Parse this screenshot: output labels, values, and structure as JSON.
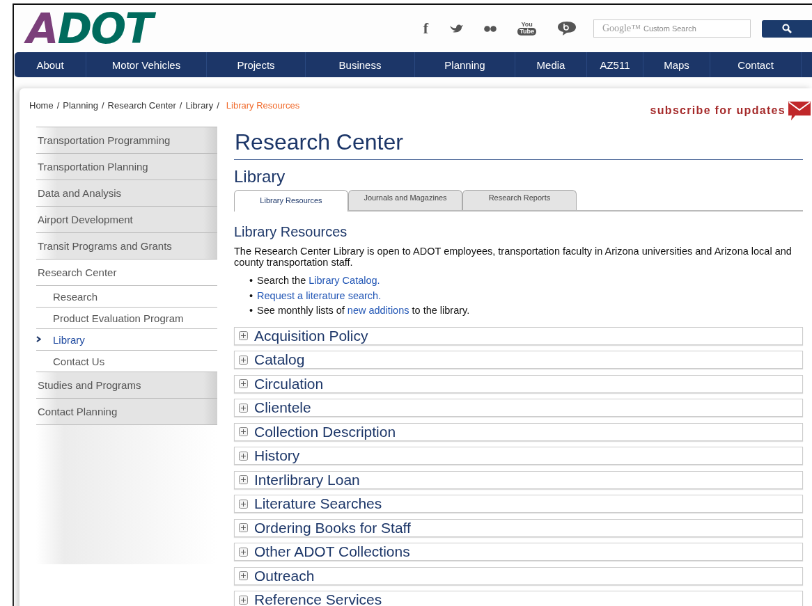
{
  "header": {
    "logo": {
      "first": "A",
      "rest": "DOT"
    },
    "social": [
      {
        "kind": "facebook",
        "glyph": "f"
      },
      {
        "kind": "twitter"
      },
      {
        "kind": "flickr"
      },
      {
        "kind": "youtube",
        "glyph": [
          "You",
          "Tube"
        ]
      },
      {
        "kind": "blog"
      }
    ],
    "search": {
      "brand": "Google™",
      "placeholder": "Custom Search"
    }
  },
  "nav": [
    "About",
    "Motor Vehicles",
    "Projects",
    "Business",
    "Planning",
    "Media",
    "AZ511",
    "Maps",
    "Contact"
  ],
  "breadcrumb": {
    "separator": "/",
    "items": [
      {
        "label": "Home",
        "current": false
      },
      {
        "label": "Planning",
        "current": false
      },
      {
        "label": "Research Center",
        "current": false
      },
      {
        "label": "Library",
        "current": false
      },
      {
        "label": "Library Resources",
        "current": true
      }
    ]
  },
  "subscribe": "subscribe for updates",
  "sidebar": [
    {
      "label": "Transportation Programming",
      "selected": false
    },
    {
      "label": "Transportation Planning",
      "selected": false
    },
    {
      "label": "Data and Analysis",
      "selected": false
    },
    {
      "label": "Airport Development",
      "selected": false
    },
    {
      "label": "Transit Programs and Grants",
      "selected": false
    },
    {
      "label": "Research Center",
      "selected": false,
      "children": [
        {
          "label": "Research",
          "selected": false
        },
        {
          "label": "Product Evaluation Program",
          "selected": false
        },
        {
          "label": "Library",
          "selected": true
        },
        {
          "label": "Contact Us",
          "selected": false
        }
      ]
    },
    {
      "label": "Studies and Programs",
      "selected": false
    },
    {
      "label": "Contact Planning",
      "selected": false
    }
  ],
  "title": "Research Center",
  "subtitle": "Library",
  "tabs": [
    {
      "label": "Library Resources",
      "selected": true
    },
    {
      "label": "Journals and Magazines",
      "selected": false
    },
    {
      "label": "Research Reports",
      "selected": false
    }
  ],
  "section_title": "Library Resources",
  "intro": "The Research Center Library is open to ADOT employees, transportation faculty in Arizona universities and Arizona local and county transportation staff.",
  "bullets": [
    {
      "marker": "•",
      "parts": [
        {
          "kind": "text",
          "text": "Search the "
        },
        {
          "kind": "link",
          "text": "Library Catalog."
        }
      ]
    },
    {
      "marker": "•",
      "parts": [
        {
          "kind": "link",
          "text": "Request a literature search."
        }
      ]
    },
    {
      "marker": "•",
      "parts": [
        {
          "kind": "text",
          "text": "See monthly lists of "
        },
        {
          "kind": "link",
          "text": "new additions"
        },
        {
          "kind": "text",
          "text": " to the library."
        }
      ]
    }
  ],
  "accordion": [
    {
      "label": "Acquisition Policy",
      "expanded": false
    },
    {
      "label": "Catalog",
      "expanded": false
    },
    {
      "label": "Circulation",
      "expanded": false
    },
    {
      "label": "Clientele",
      "expanded": false
    },
    {
      "label": "Collection Description",
      "expanded": false
    },
    {
      "label": "History",
      "expanded": false
    },
    {
      "label": "Interlibrary Loan",
      "expanded": false
    },
    {
      "label": "Literature Searches",
      "expanded": false
    },
    {
      "label": "Ordering Books for Staff",
      "expanded": false
    },
    {
      "label": "Other ADOT Collections",
      "expanded": false
    },
    {
      "label": "Outreach",
      "expanded": false
    },
    {
      "label": "Reference Services",
      "expanded": false
    }
  ]
}
